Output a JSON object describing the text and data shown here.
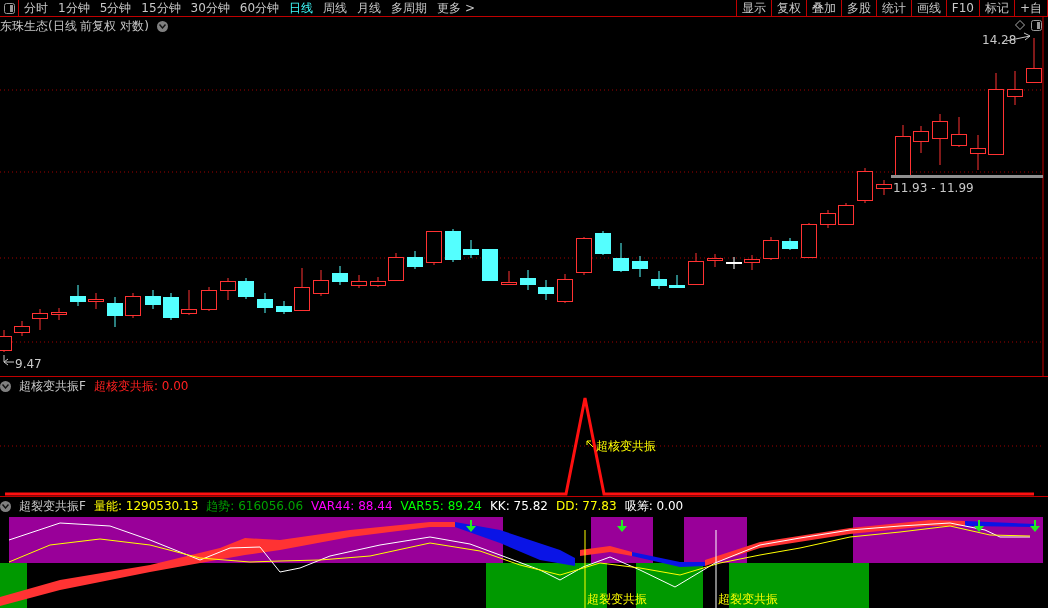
{
  "toolbar": {
    "period_tabs": [
      {
        "label": "分时",
        "selected": false
      },
      {
        "label": "1分钟",
        "selected": false
      },
      {
        "label": "5分钟",
        "selected": false
      },
      {
        "label": "15分钟",
        "selected": false
      },
      {
        "label": "30分钟",
        "selected": false
      },
      {
        "label": "60分钟",
        "selected": false
      },
      {
        "label": "日线",
        "selected": true
      },
      {
        "label": "周线",
        "selected": false
      },
      {
        "label": "月线",
        "selected": false
      },
      {
        "label": "多周期",
        "selected": false
      },
      {
        "label": "更多 >",
        "selected": false
      }
    ],
    "buttons": [
      "显示",
      "复权",
      "叠加",
      "多股",
      "统计",
      "画线",
      "F10",
      "标记",
      "+自"
    ]
  },
  "main_chart": {
    "title": "东珠生态(日线 前复权 对数)",
    "high_label": "14.28",
    "range_label": "11.93 - 11.99",
    "low_label": "9.47"
  },
  "indicator_1": {
    "name": "超核变共振F",
    "legend": [
      {
        "text": "超核变共振: 0.00",
        "color": "#ff2020"
      }
    ],
    "signal_label": "超核变共振"
  },
  "indicator_2": {
    "name": "超裂变共振F",
    "legend": [
      {
        "text": "量能: 1290530.13",
        "color": "#ffff00"
      },
      {
        "text": "趋势: 616056.06",
        "color": "#00a000"
      },
      {
        "text": "VAR44: 88.44",
        "color": "#ff00ff"
      },
      {
        "text": "VAR55: 89.24",
        "color": "#00ff00"
      },
      {
        "text": "KK: 75.82",
        "color": "#ffffff"
      },
      {
        "text": "DD: 77.83",
        "color": "#ffff00"
      },
      {
        "text": "吸筹: 0.00",
        "color": "#ffffff"
      }
    ],
    "signal_labels": [
      "超裂变共振",
      "超裂变共振"
    ]
  }
}
